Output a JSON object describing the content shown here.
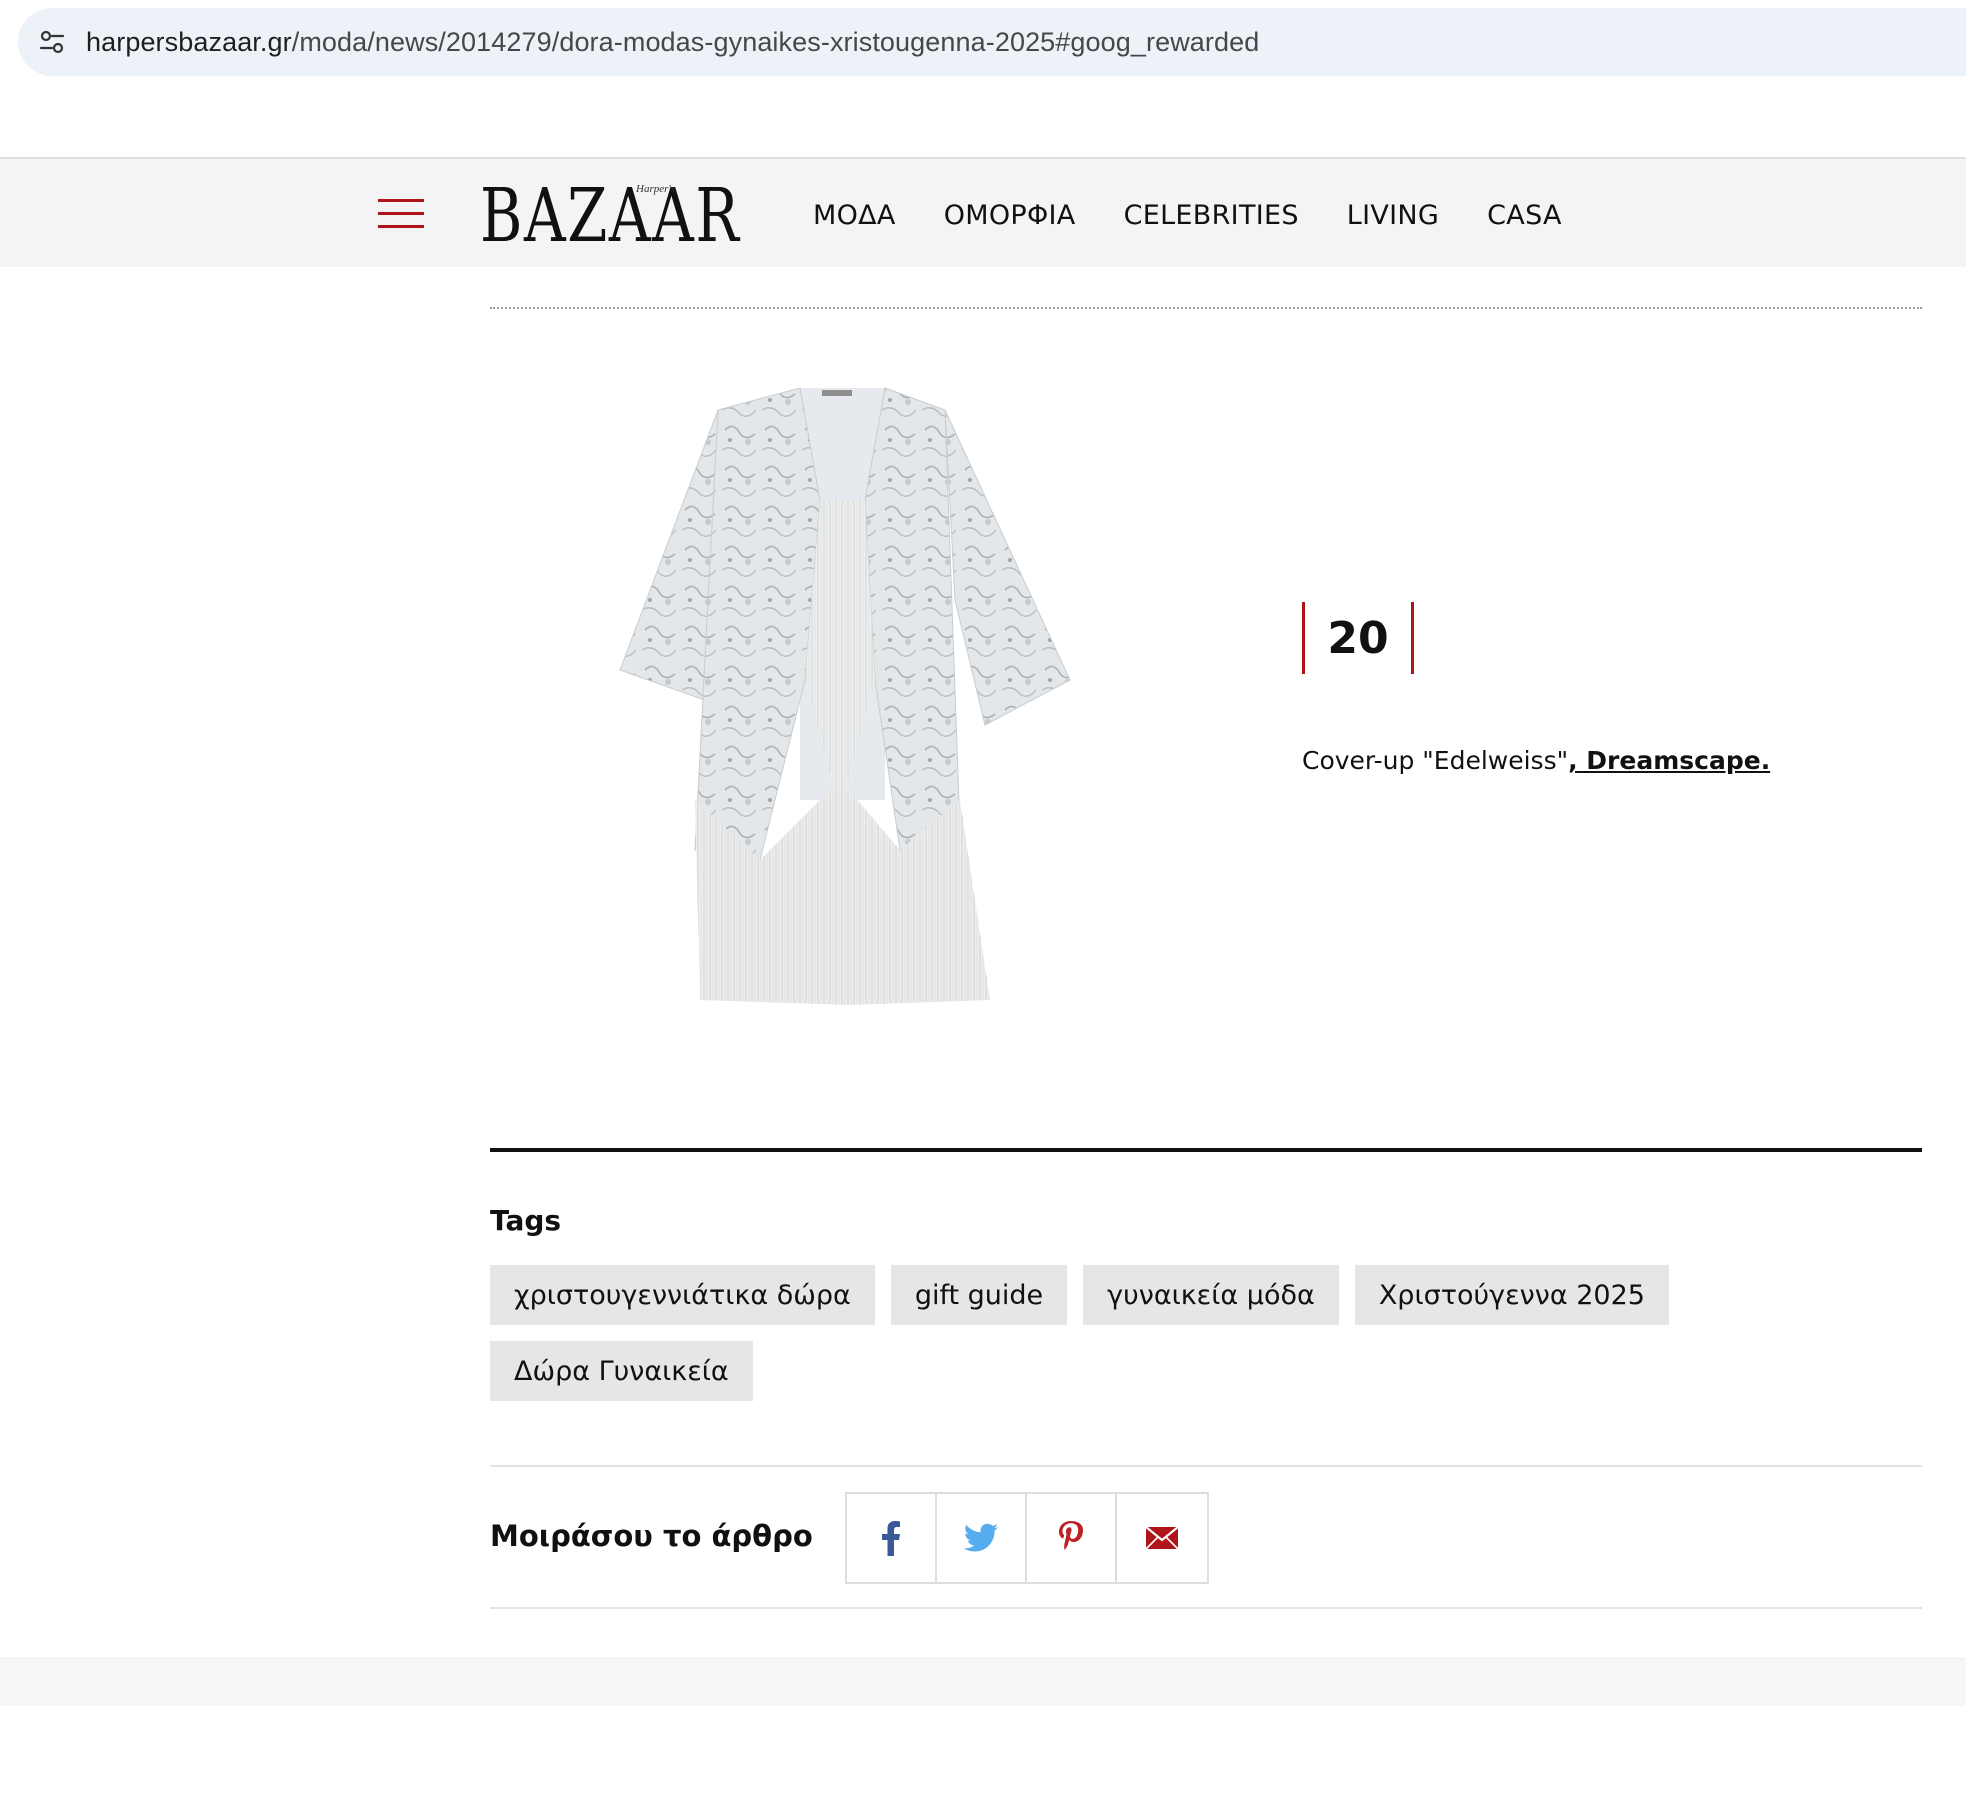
{
  "browser": {
    "url_host": "harpersbazaar.gr",
    "url_path": "/moda/news/2014279/dora-modas-gynaikes-xristougenna-2025#goog_rewarded"
  },
  "header": {
    "logo_main": "BAZAAR",
    "logo_small": "Harper's",
    "nav": [
      "ΜΟΔΑ",
      "ΟΜΟΡΦΙΑ",
      "CELEBRITIES",
      "LIVING",
      "CASA"
    ],
    "accent_color": "#b0141b"
  },
  "item": {
    "number": "20",
    "caption_text": "Cover-up \"Edelweiss\"",
    "caption_link": ", Dreamscape."
  },
  "tags": {
    "title": "Tags",
    "items": [
      "χριστουγεννιάτικα δώρα",
      "gift guide",
      "γυναικεία μόδα",
      "Χριστούγεννα 2025",
      "Δώρα Γυναικεία"
    ]
  },
  "share": {
    "label": "Μοιράσου το άρθρο",
    "icons": [
      "facebook-icon",
      "twitter-icon",
      "pinterest-icon",
      "email-icon"
    ]
  }
}
